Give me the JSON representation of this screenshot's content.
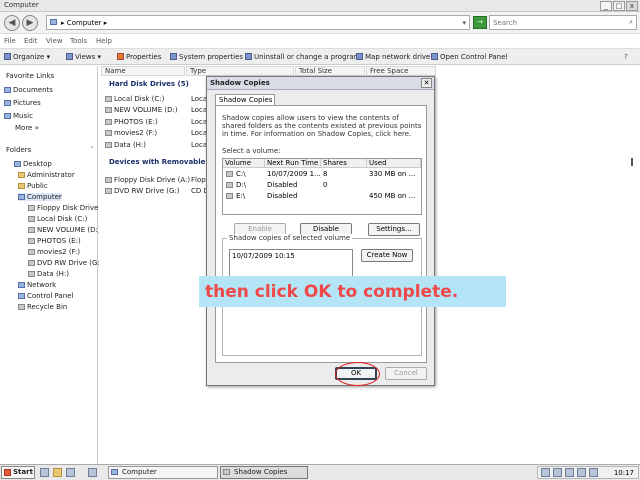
{
  "window": {
    "title": "Computer"
  },
  "nav": {
    "back_glyph": "◀",
    "forward_glyph": "▶",
    "address": "▸ Computer ▸",
    "search_placeholder": "Search",
    "go_glyph": "→"
  },
  "menu": [
    "File",
    "Edit",
    "View",
    "Tools",
    "Help"
  ],
  "toolbar": [
    "Organize ▾",
    "Views ▾",
    "Properties",
    "System properties",
    "Uninstall or change a program",
    "Map network drive",
    "Open Control Panel"
  ],
  "left": {
    "favorites_header": "Favorite Links",
    "favorites": [
      "Documents",
      "Pictures",
      "Music",
      "More »"
    ],
    "folders_header": "Folders",
    "tree": [
      "Desktop",
      "Administrator",
      "Public",
      "Computer",
      "Floppy Disk Drive (A:)",
      "Local Disk (C:)",
      "NEW VOLUME (D:)",
      "PHOTOS (E:)",
      "movies2 (F:)",
      "DVD RW Drive (G:)",
      "Data (H:)",
      "Network",
      "Control Panel",
      "Recycle Bin"
    ]
  },
  "columns": [
    "Name",
    "Type",
    "Total Size",
    "Free Space"
  ],
  "groups": {
    "hdd": "Hard Disk Drives (5)",
    "removable": "Devices with Removable Storage"
  },
  "drives": [
    "Local Disk (C:)",
    "NEW VOLUME (D:)",
    "PHOTOS (E:)",
    "movies2 (F:)",
    "Data (H:)"
  ],
  "drive_types": [
    "Local",
    "Local",
    "Local",
    "Local",
    "Local"
  ],
  "removable": [
    "Floppy Disk Drive (A:)",
    "DVD RW Drive (G:)"
  ],
  "removable_types": [
    "Flopp",
    "CD D"
  ],
  "dialog": {
    "title": "Shadow Copies",
    "close_glyph": "✕",
    "tab": "Shadow Copies",
    "description": "Shadow copies allow users to view the contents of shared folders as the contents existed at previous points in time. For information on Shadow Copies, click here.",
    "select_volume": "Select a volume:",
    "headers": [
      "Volume",
      "Next Run Time",
      "Shares",
      "Used"
    ],
    "volumes": [
      {
        "volume": "C:\\",
        "next": "10/07/2009 1...",
        "shares": "8",
        "used": "330 MB on ..."
      },
      {
        "volume": "D:\\",
        "next": "Disabled",
        "shares": "0",
        "used": ""
      },
      {
        "volume": "E:\\",
        "next": "Disabled",
        "shares": "",
        "used": "450 MB on ..."
      }
    ],
    "enable": "Enable",
    "disable": "Disable",
    "settings": "Settings...",
    "group_label": "Shadow copies of selected volume",
    "copy_item": "10/07/2009 10:15",
    "create_now": "Create Now",
    "ok": "OK",
    "cancel": "Cancel"
  },
  "callout": "then click OK to complete.",
  "taskbar": {
    "start": "Start",
    "tasks": [
      "Computer",
      "Shadow Copies"
    ],
    "clock": "10:17"
  }
}
